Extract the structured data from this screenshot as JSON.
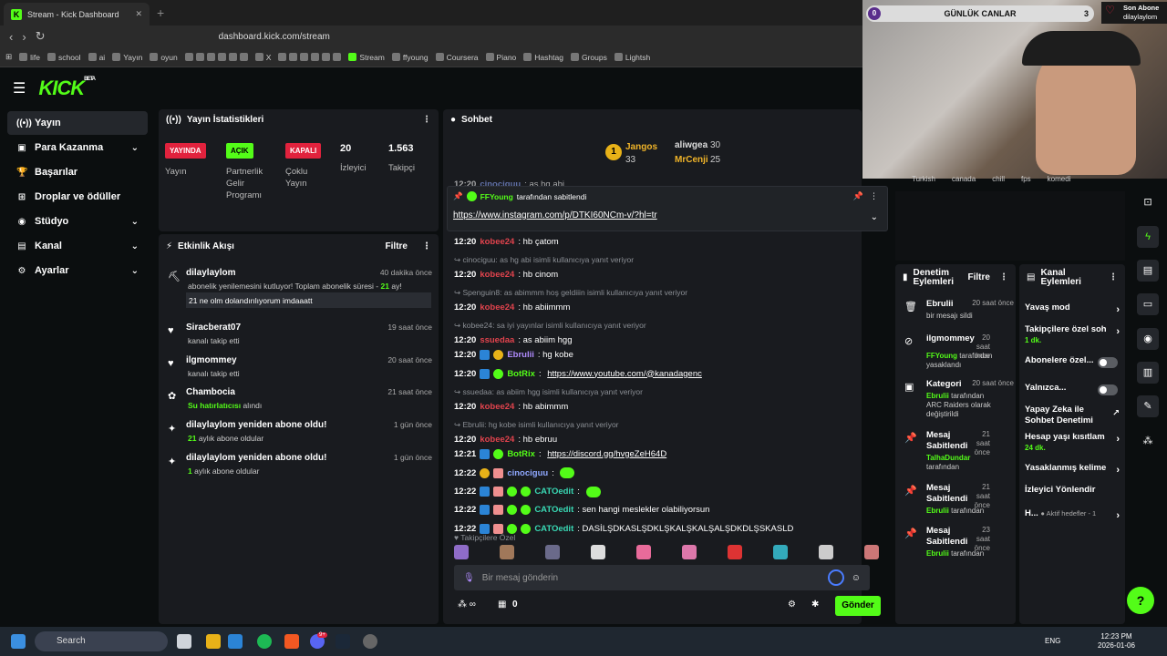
{
  "browser": {
    "tab_title": "Stream - Kick Dashboard",
    "url": "dashboard.kick.com/stream",
    "bookmarks": [
      "life",
      "school",
      "ai",
      "Yayın",
      "oyun",
      "X",
      "Stream",
      "ffyoung",
      "Coursera",
      "Piano",
      "Hashtag",
      "Groups",
      "Lightsh"
    ]
  },
  "kick": {
    "logo": "KICK",
    "logo_beta": "BETA",
    "nav": [
      {
        "label": "Yayın",
        "icon": "broadcast-icon",
        "expand": ""
      },
      {
        "label": "Para Kazanma",
        "icon": "money-icon",
        "expand": "⌄"
      },
      {
        "label": "Başarılar",
        "icon": "trophy-icon",
        "expand": ""
      },
      {
        "label": "Droplar ve ödüller",
        "icon": "gift-icon",
        "expand": ""
      },
      {
        "label": "Stüdyo",
        "icon": "studio-icon",
        "expand": "⌄"
      },
      {
        "label": "Kanal",
        "icon": "channel-icon",
        "expand": "⌄"
      },
      {
        "label": "Ayarlar",
        "icon": "gear-icon",
        "expand": "⌄"
      }
    ]
  },
  "stats": {
    "title": "Yayın İstatistikleri",
    "badges": [
      {
        "value": "YAYINDA",
        "label": "Yayın",
        "color": "#e1223d"
      },
      {
        "value": "AÇIK",
        "label": "Partnerlik Gelir Programı",
        "color": "#53fc18"
      },
      {
        "value": "KAPALI",
        "label": "Çoklu Yayın",
        "color": "#e1223d"
      }
    ],
    "viewers_value": "20",
    "viewers_label": "İzleyici",
    "followers_value": "1.563",
    "followers_label": "Takipçi"
  },
  "activity": {
    "title": "Etkinlik Akışı",
    "filter": "Filtre",
    "items": [
      {
        "name": "dilaylaylom",
        "time": "40 dakika önce",
        "sub_pre": "abonelik yenilemesini kutluyor! Toplam abonelik süresi - ",
        "sub_hl": "21",
        "sub_post": " ay!",
        "msg": "21 ne olm dolandırılıyorum imdaaatt",
        "icon": "pickaxe-icon"
      },
      {
        "name": "Siracberat07",
        "time": "19 saat önce",
        "sub_pre": "kanalı takip etti",
        "icon": "heart-icon"
      },
      {
        "name": "ilgmommey",
        "time": "20 saat önce",
        "sub_pre": "kanalı takip etti",
        "icon": "heart-icon"
      },
      {
        "name": "Chambocia",
        "time": "21 saat önce",
        "sub_hl": "Su hatırlatıcısı",
        "sub_post": " alındı",
        "icon": "reward-icon"
      },
      {
        "name": "dilaylaylom yeniden abone oldu!",
        "time": "1 gün önce",
        "sub_hl": "21",
        "sub_post": " aylık abone oldular",
        "icon": "sparkle-icon"
      },
      {
        "name": "dilaylaylom yeniden abone oldu!",
        "time": "1 gün önce",
        "sub_hl": "1",
        "sub_post": " aylık abone oldular",
        "icon": "sparkle-icon"
      }
    ]
  },
  "chat": {
    "title": "Sohbet",
    "top_tippers": [
      {
        "rank": "1",
        "name": "Jangos",
        "amount": "33"
      },
      {
        "name": "aliwgea",
        "amount": "30"
      },
      {
        "name": "MrCenji",
        "amount": "25"
      }
    ],
    "pinned_by": "FFYoung",
    "pinned_suffix": "tarafından sabitlendi",
    "pinned_link": "https://www.instagram.com/p/DTKI60NCm-v/?hl=tr",
    "partial_line": {
      "time": "12:20",
      "user": "cinociguu",
      "text": ": as hg abi"
    },
    "lines": [
      {
        "type": "msg",
        "time": "12:20",
        "user": "kobee24",
        "color": "red",
        "text": ": hb çatom"
      },
      {
        "type": "reply",
        "text": "cinociguu: as hg abi isimli kullanıcıya yanıt veriyor"
      },
      {
        "type": "msg",
        "time": "12:20",
        "user": "kobee24",
        "color": "red",
        "text": ": hb cinom"
      },
      {
        "type": "reply",
        "text": "Spenguin8: as abimmm hoş geldiiin isimli kullanıcıya yanıt veriyor"
      },
      {
        "type": "msg",
        "time": "12:20",
        "user": "kobee24",
        "color": "red",
        "text": ": hb abiimmm"
      },
      {
        "type": "reply",
        "text": "kobee24: sa iyi yayınlar isimli kullanıcıya yanıt veriyor"
      },
      {
        "type": "msg",
        "time": "12:20",
        "user": "ssuedaa",
        "color": "red",
        "text": ": as abiim hgg"
      },
      {
        "type": "msg",
        "time": "12:20",
        "user": "Ebrulii",
        "color": "purple",
        "text": ": hg kobe",
        "badges": [
          "sub",
          "gold"
        ]
      },
      {
        "type": "msg",
        "time": "12:20",
        "user": "BotRix",
        "color": "green",
        "text": ": ",
        "link": "https://www.youtube.com/@kanadagenc",
        "badges": [
          "sub",
          "ver"
        ]
      },
      {
        "type": "reply",
        "text": "ssuedaa: as abiim hgg isimli kullanıcıya yanıt veriyor"
      },
      {
        "type": "msg",
        "time": "12:20",
        "user": "kobee24",
        "color": "red",
        "text": ": hb abimmm"
      },
      {
        "type": "reply",
        "text": "Ebrulii: hg kobe isimli kullanıcıya yanıt veriyor"
      },
      {
        "type": "msg",
        "time": "12:20",
        "user": "kobee24",
        "color": "red",
        "text": ": hb ebruu"
      },
      {
        "type": "msg",
        "time": "12:21",
        "user": "BotRix",
        "color": "green",
        "text": ": ",
        "link": "https://discord.gg/hvgeZeH64D",
        "badges": [
          "sub",
          "ver"
        ]
      },
      {
        "type": "msg",
        "time": "12:22",
        "user": "cinociguu",
        "color": "blue",
        "text": ": ",
        "emote": true,
        "badges": [
          "gold",
          "gift"
        ]
      },
      {
        "type": "msg",
        "time": "12:22",
        "user": "CATOedit",
        "color": "teal",
        "text": ": ",
        "emote": true,
        "badges": [
          "sub",
          "gift",
          "mod",
          "ver"
        ]
      },
      {
        "type": "msg",
        "time": "12:22",
        "user": "CATOedit",
        "color": "teal",
        "text": ": sen hangi meslekler olabiliyorsun",
        "badges": [
          "sub",
          "gift",
          "mod",
          "ver"
        ]
      },
      {
        "type": "msg",
        "time": "12:22",
        "user": "CATOedit",
        "color": "teal",
        "text": ": DASİLŞDKASLŞDKLŞKALŞKALŞALŞDKDLŞSKASLD",
        "badges": [
          "sub",
          "gift",
          "mod",
          "ver"
        ]
      }
    ],
    "followers_only": "Takipçilere Özel",
    "placeholder": "Bir mesaj gönderin",
    "points": "0",
    "send": "Gönder"
  },
  "overlay": {
    "goal_left": "0",
    "goal_label": "GÜNLÜK CANLAR",
    "goal_right": "3",
    "last_sub_title": "Son Abone",
    "last_sub_name": "dilaylaylom",
    "tags": [
      "Turkish",
      "canada",
      "chill",
      "fps",
      "komedi"
    ]
  },
  "moderation": {
    "title": "Denetim Eylemleri",
    "filter": "Filtre",
    "items": [
      {
        "name": "Ebrulii",
        "time": "20 saat önce",
        "sub": "bir mesajı sildi",
        "icon": "trash-icon"
      },
      {
        "name": "ilgmommey",
        "time": "20 saat önce",
        "sub_hl": "FFYoung",
        "sub": " tarafından yasaklandı",
        "icon": "ban-icon"
      },
      {
        "name": "Kategori",
        "time": "20 saat önce",
        "sub_hl": "Ebrulii",
        "sub": " tarafından ARC Raiders olarak değiştirildi",
        "icon": "category-icon"
      },
      {
        "name": "Mesaj Sabitlendi",
        "time": "21 saat önce",
        "sub_hl": "TalhaDundar",
        "sub": " tarafından",
        "icon": "pin-icon"
      },
      {
        "name": "Mesaj Sabitlendi",
        "time": "21 saat önce",
        "sub_hl": "Ebrulii",
        "sub": " tarafından",
        "icon": "pin-icon"
      },
      {
        "name": "Mesaj Sabitlendi",
        "time": "23 saat önce",
        "sub_hl": "Ebrulii",
        "sub": " tarafından",
        "icon": "pin-icon"
      }
    ]
  },
  "channel_actions": {
    "title": "Kanal Eylemleri",
    "items": [
      {
        "label": "Yavaş mod",
        "ctrl": "chev"
      },
      {
        "label": "Takipçilere özel soh",
        "sub": "1 dk.",
        "ctrl": "chev"
      },
      {
        "label": "Abonelere özel...",
        "ctrl": "toggle"
      },
      {
        "label": "Yalnızca...",
        "ctrl": "toggle"
      },
      {
        "label": "Yapay Zeka ile Sohbet Denetimi",
        "ctrl": "ext"
      },
      {
        "label": "Hesap yaşı kısıtlam",
        "sub": "24 dk.",
        "ctrl": "chev"
      },
      {
        "label": "Yasaklanmış kelime",
        "ctrl": "chev"
      },
      {
        "label": "İzleyici Yönlendir",
        "ctrl": ""
      },
      {
        "label": "H...",
        "sub": "● Aktif hedefler - 1",
        "ctrl": "chev"
      }
    ]
  },
  "taskbar": {
    "search": "Search",
    "lang": "ENG",
    "time": "12:23 PM",
    "date": "2026-01-06",
    "discord_badge": "9+"
  }
}
